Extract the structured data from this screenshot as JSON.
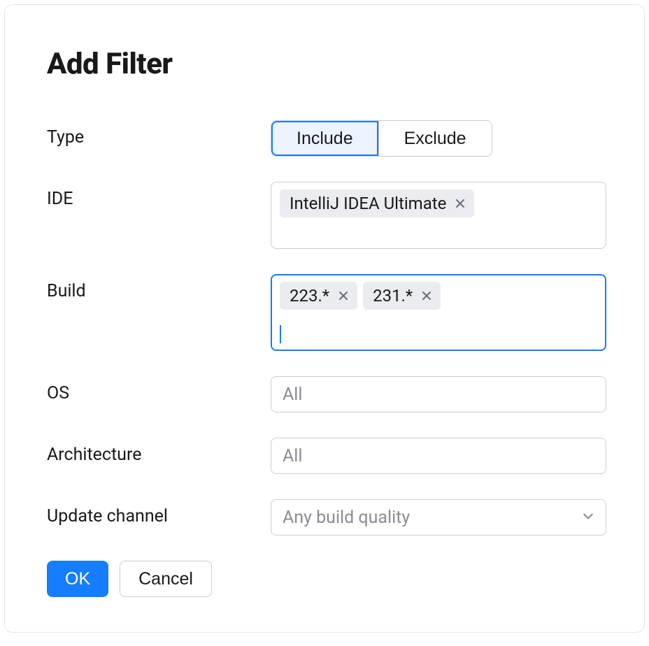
{
  "title": "Add Filter",
  "form": {
    "type": {
      "label": "Type",
      "options": [
        "Include",
        "Exclude"
      ],
      "selected": "Include"
    },
    "ide": {
      "label": "IDE",
      "tags": [
        "IntelliJ IDEA Ultimate"
      ]
    },
    "build": {
      "label": "Build",
      "tags": [
        "223.*",
        "231.*"
      ],
      "focused": true
    },
    "os": {
      "label": "OS",
      "placeholder": "All"
    },
    "architecture": {
      "label": "Architecture",
      "placeholder": "All"
    },
    "update_channel": {
      "label": "Update channel",
      "placeholder": "Any build quality"
    }
  },
  "buttons": {
    "ok": "OK",
    "cancel": "Cancel"
  },
  "colors": {
    "accent": "#167dff",
    "accent_bg": "#edf3ff",
    "border": "#cdcdd1",
    "tag_bg": "#ebecf0",
    "placeholder": "#8b8b96",
    "text": "#19191c"
  }
}
